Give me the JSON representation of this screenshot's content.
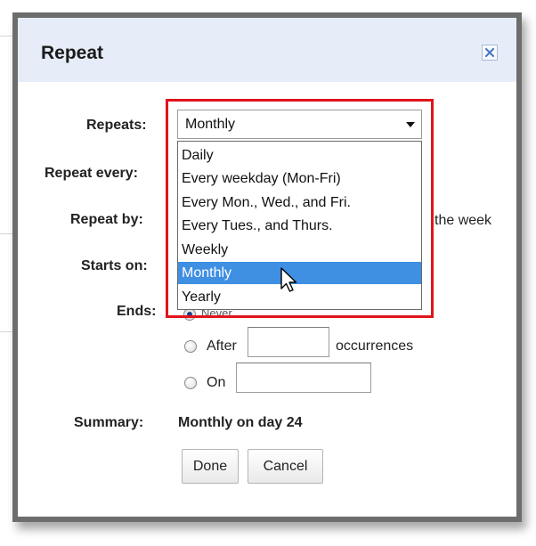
{
  "dialog": {
    "title": "Repeat",
    "close_icon": "close-icon"
  },
  "form": {
    "repeats_label": "Repeats:",
    "repeat_every_label": "Repeat every:",
    "repeat_by_label": "Repeat by:",
    "repeat_by_partial_text": "the week",
    "starts_on_label": "Starts on:",
    "ends_label": "Ends:",
    "ends_never_partial": "Never",
    "ends_after_label": "After",
    "ends_after_suffix": "occurrences",
    "ends_after_value": "",
    "ends_on_label": "On",
    "ends_on_value": "",
    "summary_label": "Summary:",
    "summary_value": "Monthly on day 24"
  },
  "repeats_select": {
    "selected_value": "Monthly",
    "options": [
      "Daily",
      "Every weekday (Mon-Fri)",
      "Every Mon., Wed., and Fri.",
      "Every Tues., and Thurs.",
      "Weekly",
      "Monthly",
      "Yearly"
    ],
    "highlighted_index": 5
  },
  "buttons": {
    "done_label": "Done",
    "cancel_label": "Cancel"
  },
  "colors": {
    "header_bg": "#e6edf8",
    "highlight_border": "#e0141b",
    "selected_option_bg": "#3f8fe3",
    "dialog_border": "#6d6d6d"
  }
}
